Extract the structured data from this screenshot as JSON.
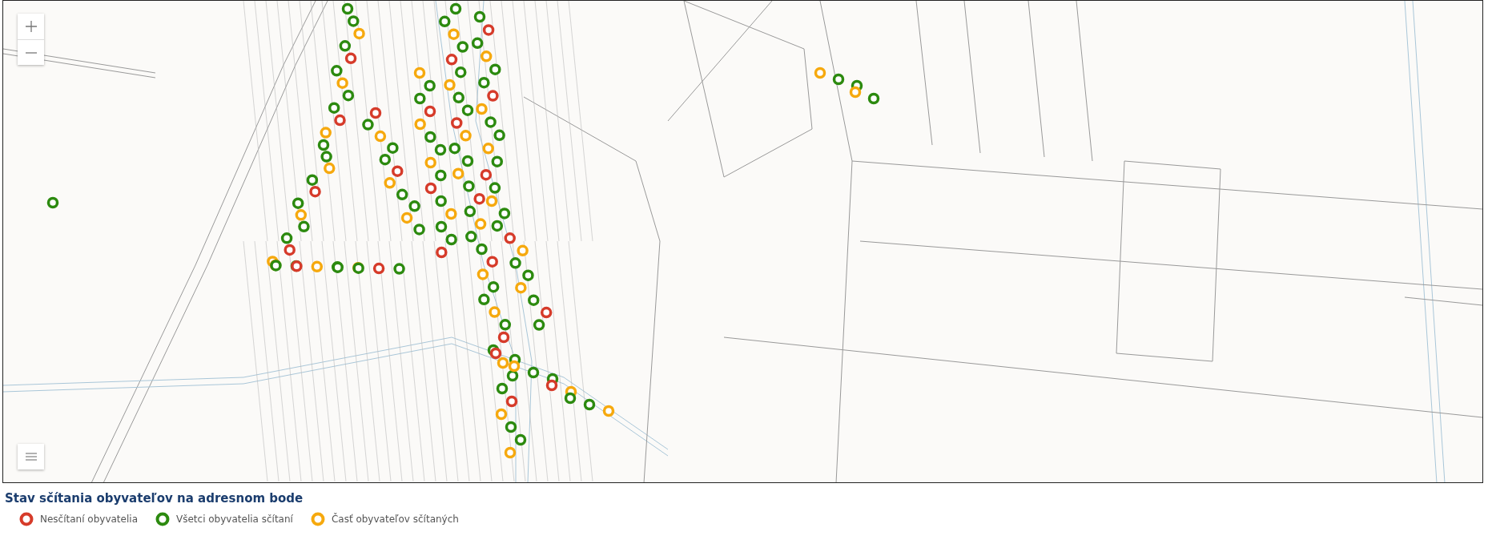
{
  "map": {
    "zoom_in": {
      "kind": "zoom-in"
    },
    "zoom_out": {
      "kind": "zoom-out"
    }
  },
  "legend": {
    "title": "Stav sčítania obyvateľov na adresnom bode",
    "items": [
      {
        "label": "Nesčítaní obyvatelia",
        "color": "#d63b2a"
      },
      {
        "label": "Všetci obyvatelia sčítaní",
        "color": "#2c8a0f"
      },
      {
        "label": "Časť obyvateľov sčítaných",
        "color": "#f6a90e"
      }
    ]
  }
}
